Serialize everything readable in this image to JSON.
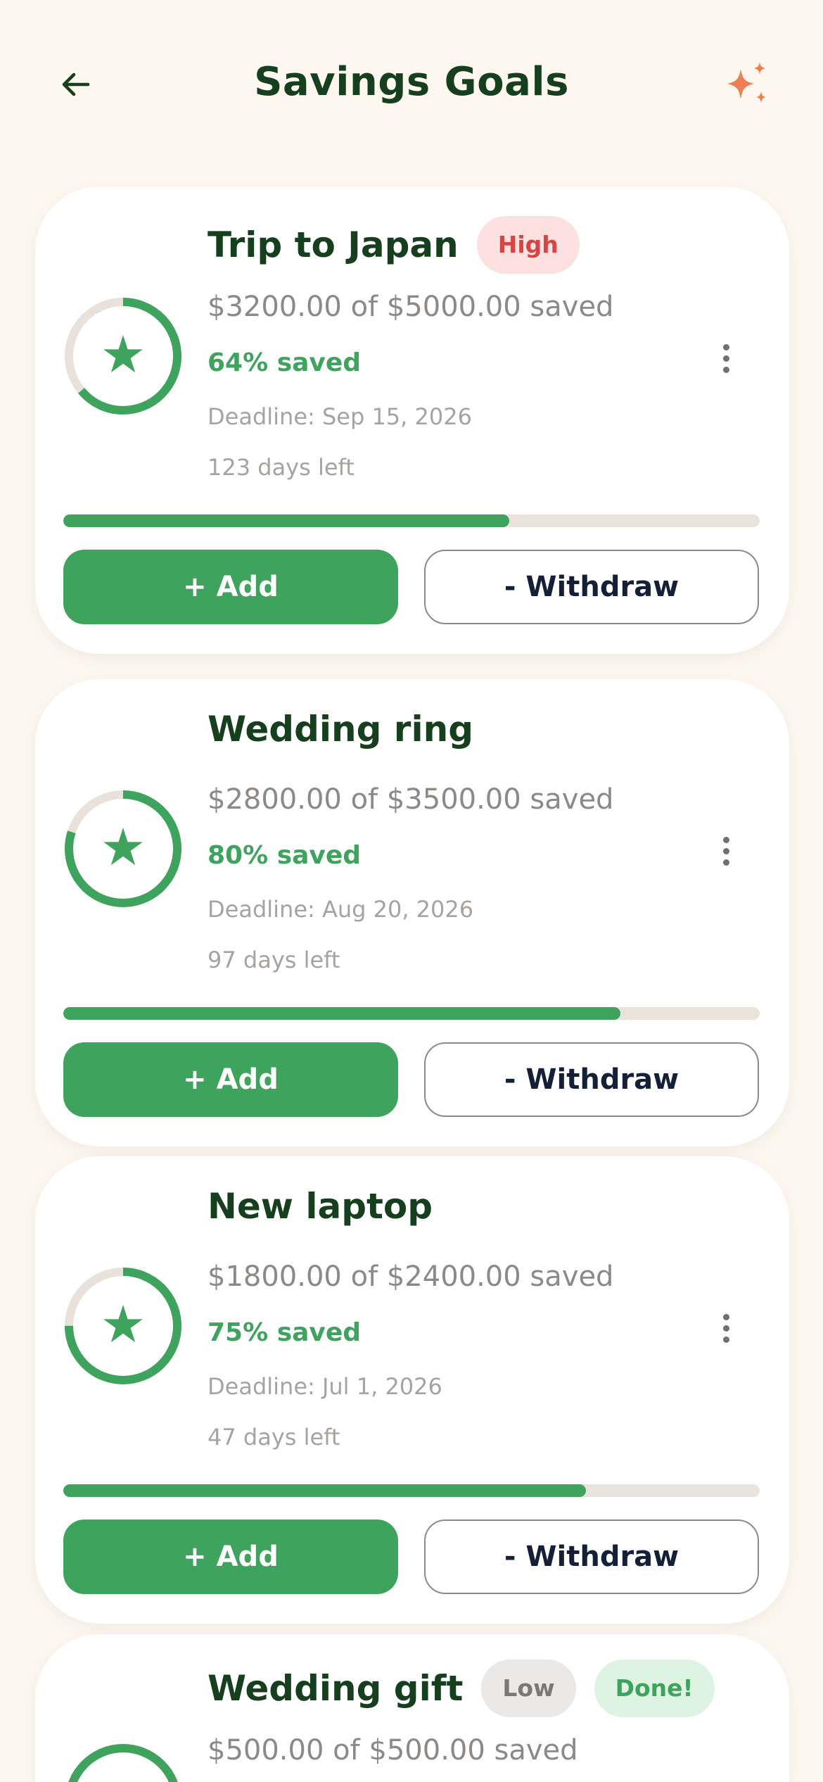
{
  "header": {
    "title": "Savings Goals",
    "back_icon": "arrow-left-icon",
    "action_icon": "sparkles-icon"
  },
  "colors": {
    "background": "#fdf7f0",
    "primary_green": "#3ea35c",
    "title_green": "#153f1d",
    "sparkle_orange": "#f07e55",
    "badge_high_bg": "#fde1e1",
    "badge_high_text": "#d84343",
    "badge_low_bg": "#ebe9e7",
    "badge_low_text": "#7b7875",
    "badge_done_bg": "#dff3e3",
    "badge_done_text": "#3ea35c"
  },
  "goals": [
    {
      "name": "Trip to Japan",
      "badges": [
        {
          "label": "High",
          "kind": "high"
        }
      ],
      "amount_text": "$3200.00 of $5000.00 saved",
      "percent_text": "64% saved",
      "deadline": "Deadline: Sep 15, 2026",
      "days_left": "123 days left",
      "progress": 0.64,
      "add_label": "+ Add",
      "withdraw_label": "- Withdraw"
    },
    {
      "name": "Wedding ring",
      "badges": [],
      "amount_text": "$2800.00 of $3500.00 saved",
      "percent_text": "80% saved",
      "deadline": "Deadline: Aug 20, 2026",
      "days_left": "97 days left",
      "progress": 0.8,
      "add_label": "+ Add",
      "withdraw_label": "- Withdraw"
    },
    {
      "name": "New laptop",
      "badges": [],
      "amount_text": "$1800.00 of $2400.00 saved",
      "percent_text": "75% saved",
      "deadline": "Deadline: Jul 1, 2026",
      "days_left": "47 days left",
      "progress": 0.75,
      "add_label": "+ Add",
      "withdraw_label": "- Withdraw"
    },
    {
      "name": "Wedding gift",
      "badges": [
        {
          "label": "Low",
          "kind": "low"
        },
        {
          "label": "Done!",
          "kind": "done"
        }
      ],
      "amount_text": "$500.00 of $500.00 saved",
      "progress": 1.0
    }
  ]
}
